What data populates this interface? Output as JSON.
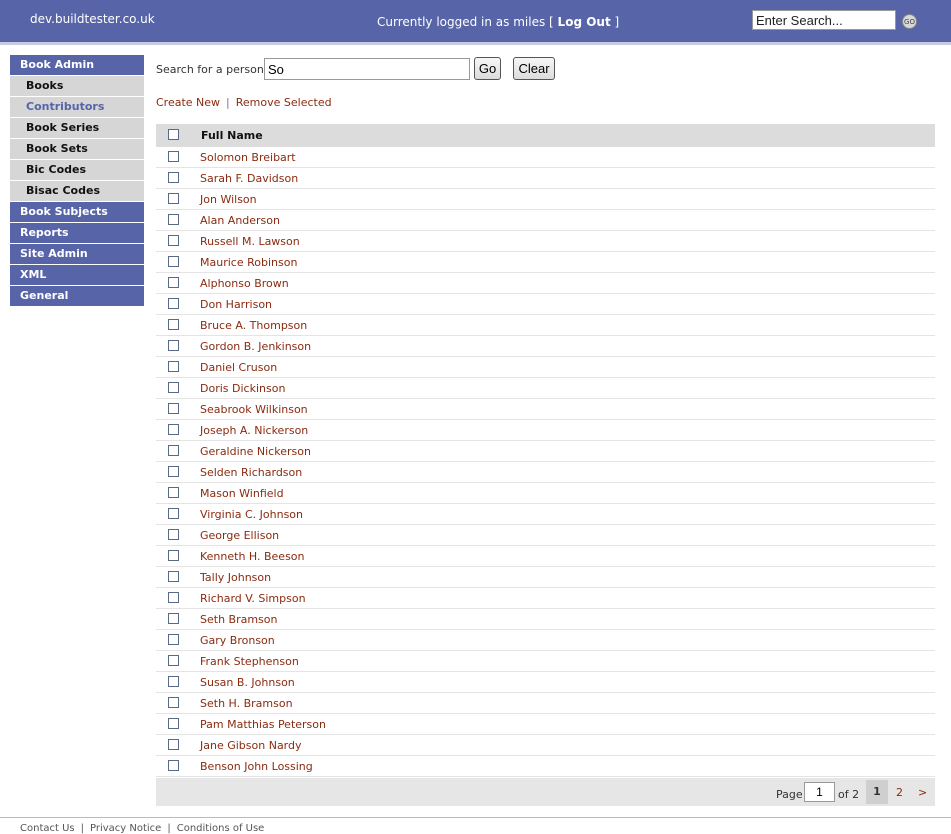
{
  "header": {
    "site_name": "dev.buildtester.co.uk",
    "login_prefix": "Currently logged in as miles [",
    "logout_label": "Log Out",
    "login_suffix": "]",
    "search_value": "Enter Search...",
    "go_label": "GO"
  },
  "nav": {
    "book_admin": "Book Admin",
    "sub_items": [
      "Books",
      "Contributors",
      "Book Series",
      "Book Sets",
      "Bic Codes",
      "Bisac Codes"
    ],
    "active_sub": "Contributors",
    "main_items": [
      "Book Subjects",
      "Reports",
      "Site Admin",
      "XML",
      "General"
    ]
  },
  "search": {
    "label": "Search for a person:",
    "value": "So",
    "go_label": "Go",
    "clear_label": "Clear"
  },
  "actions": {
    "create_new": "Create New",
    "separator": "|",
    "remove_selected": "Remove Selected"
  },
  "table": {
    "header": "Full Name",
    "rows": [
      "Solomon Breibart",
      "Sarah F. Davidson",
      "Jon Wilson",
      "Alan Anderson",
      "Russell M. Lawson",
      "Maurice Robinson",
      "Alphonso Brown",
      "Don Harrison",
      "Bruce A. Thompson",
      "Gordon B. Jenkinson",
      "Daniel Cruson",
      "Doris Dickinson",
      "Seabrook Wilkinson",
      "Joseph A. Nickerson",
      "Geraldine Nickerson",
      "Selden Richardson",
      "Mason Winfield",
      "Virginia C. Johnson",
      "George Ellison",
      "Kenneth H. Beeson",
      "Tally Johnson",
      "Richard V. Simpson",
      "Seth Bramson",
      "Gary Bronson",
      "Frank Stephenson",
      "Susan B. Johnson",
      "Seth H. Bramson",
      "Pam Matthias Peterson",
      "Jane Gibson Nardy",
      "Benson John Lossing"
    ]
  },
  "pager": {
    "page_label": "Page",
    "page_value": "1",
    "of_label": "of 2",
    "page1": "1",
    "page2": "2",
    "next": ">"
  },
  "footer": {
    "contact": "Contact Us",
    "privacy": "Privacy Notice",
    "conditions": "Conditions of Use",
    "separator": "|"
  },
  "colors": {
    "brand": "#5764a8",
    "link": "#8a2b10"
  }
}
